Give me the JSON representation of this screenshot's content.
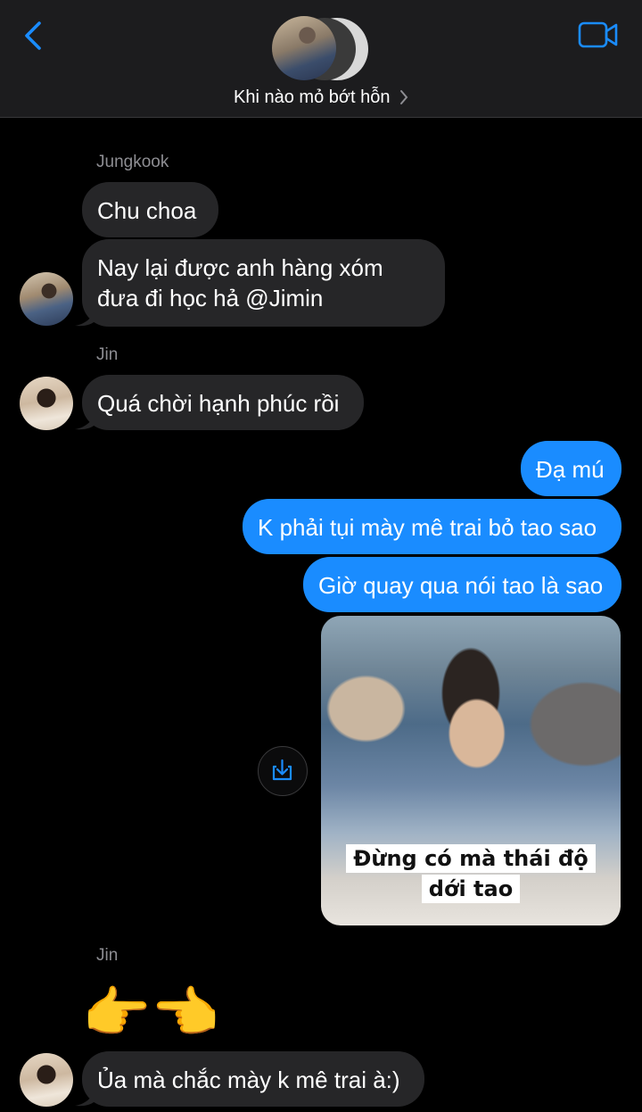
{
  "header": {
    "group_name": "Khi nào mỏ bớt hỗn",
    "icons": {
      "back": "chevron-left-icon",
      "video": "video-camera-icon",
      "chevron": "chevron-right-icon"
    },
    "accent_color": "#1a8cff"
  },
  "messages": [
    {
      "sender": "Jungkook",
      "text": "Chu choa"
    },
    {
      "sender": "Jungkook",
      "lines": [
        "Nay lại được anh hàng xóm",
        "đưa đi học hả @Jimin"
      ]
    },
    {
      "sender": "Jin",
      "text": "Quá chời hạnh phúc rồi"
    },
    {
      "sender": "me",
      "text": "Đạ mú"
    },
    {
      "sender": "me",
      "text": "K phải tụi mày mê trai bỏ tao sao"
    },
    {
      "sender": "me",
      "text": "Giờ quay qua nói tao là sao"
    },
    {
      "sender": "me",
      "type": "image",
      "caption_lines": [
        "Đừng có mà thái độ",
        "dới tao"
      ]
    },
    {
      "sender": "Jin",
      "text": "👉👈"
    },
    {
      "sender": "Jin",
      "text": "Ủa mà chắc mày k mê trai à:)"
    }
  ],
  "names": {
    "jungkook": "Jungkook",
    "jin": "Jin"
  },
  "download_icon": "download-icon"
}
